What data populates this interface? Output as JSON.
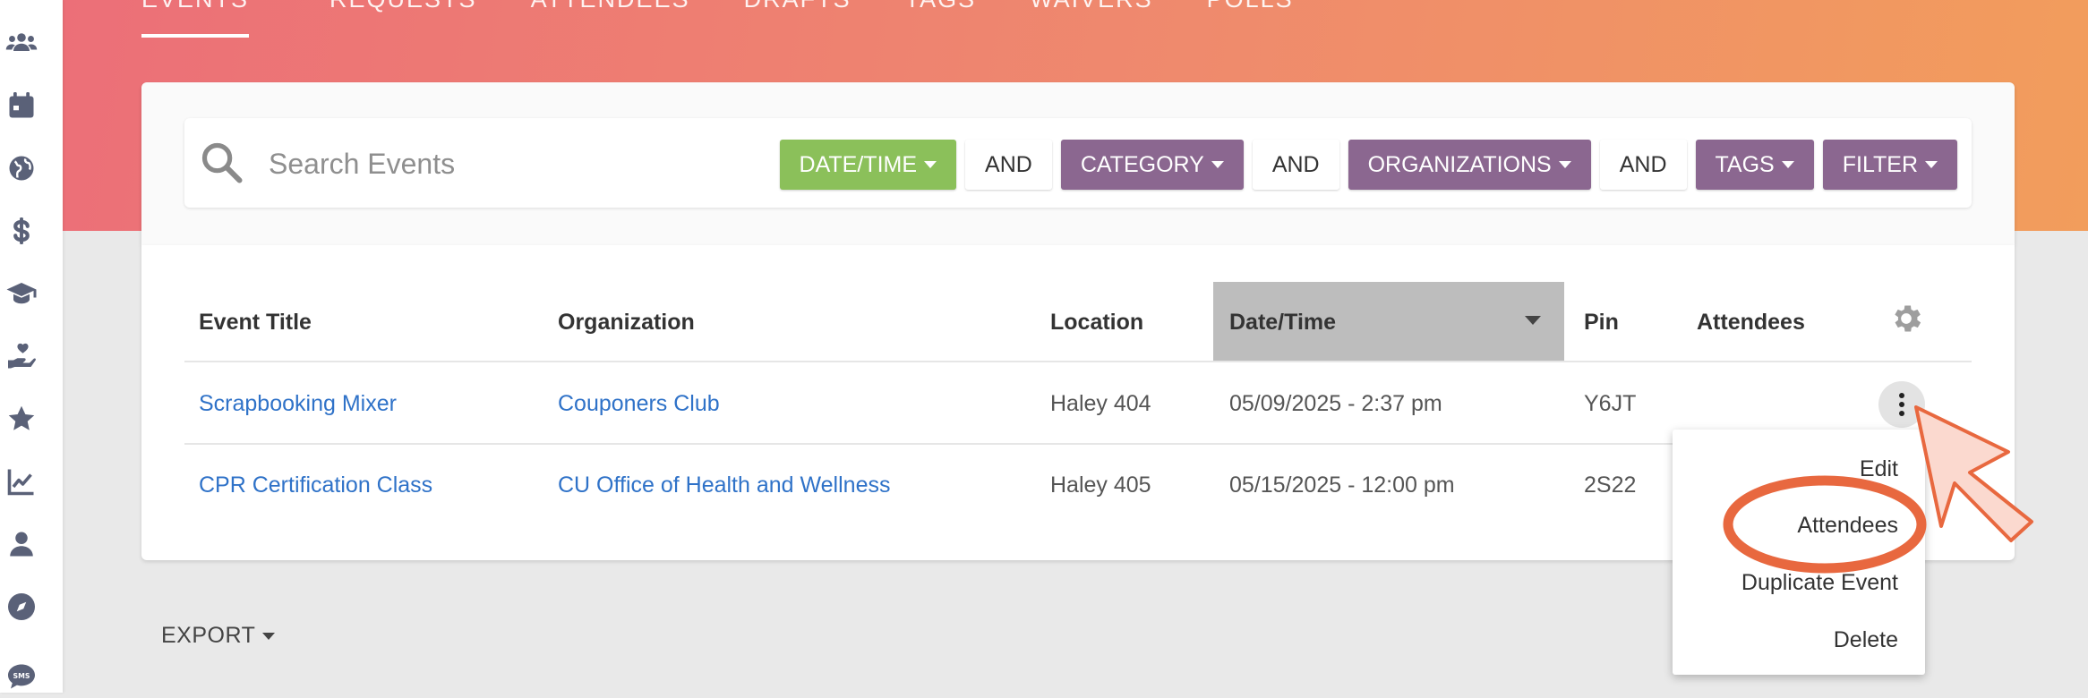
{
  "nav_tabs": [
    "EVENTS",
    "REQUESTS",
    "ATTENDEES",
    "DRAFTS",
    "TAGS",
    "WAIVERS",
    "POLLS"
  ],
  "rail_icons": [
    "users-icon",
    "calendar-icon",
    "globe-icon",
    "dollar-icon",
    "graduation-cap-icon",
    "hand-heart-icon",
    "star-icon",
    "chart-line-icon",
    "user-icon",
    "compass-icon",
    "sms-icon"
  ],
  "search": {
    "placeholder": "Search Events"
  },
  "filters": {
    "datetime": "DATE/TIME",
    "and1": "AND",
    "category": "CATEGORY",
    "and2": "AND",
    "organizations": "ORGANIZATIONS",
    "and3": "AND",
    "tags": "TAGS",
    "filter": "FILTER"
  },
  "table": {
    "headers": {
      "title": "Event Title",
      "organization": "Organization",
      "location": "Location",
      "datetime": "Date/Time",
      "pin": "Pin",
      "attendees": "Attendees"
    },
    "rows": [
      {
        "title": "Scrapbooking Mixer",
        "organization": "Couponers Club",
        "location": "Haley 404",
        "datetime": "05/09/2025 - 2:37 pm",
        "pin": "Y6JT"
      },
      {
        "title": "CPR Certification Class",
        "organization": "CU Office of Health and Wellness",
        "location": "Haley 405",
        "datetime": "05/15/2025 - 12:00 pm",
        "pin": "2S22"
      }
    ]
  },
  "menu": {
    "edit": "Edit",
    "attendees": "Attendees",
    "duplicate": "Duplicate Event",
    "delete": "Delete"
  },
  "export": "EXPORT",
  "colors": {
    "accent_green": "#8bc05a",
    "accent_purple": "#8b6790",
    "link_blue": "#2f72c8",
    "highlight_orange": "#e8683f"
  }
}
